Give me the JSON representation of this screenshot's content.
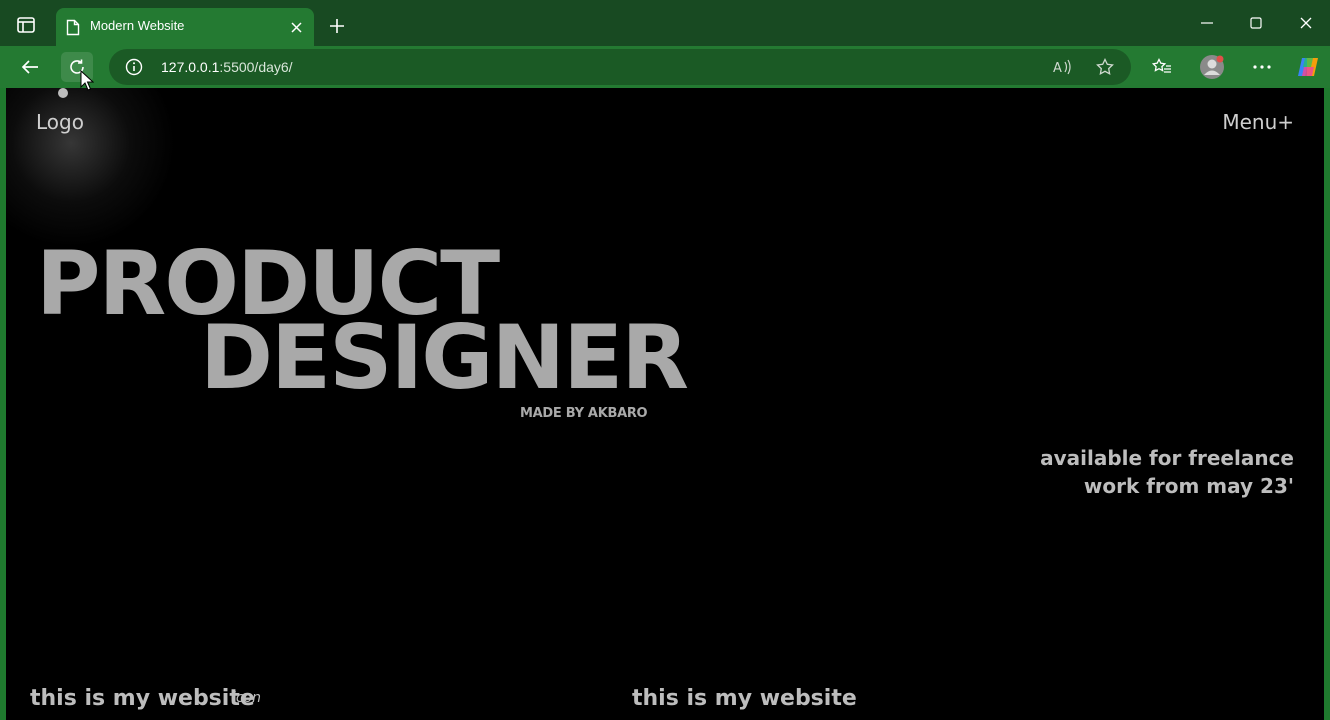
{
  "browser": {
    "tab_title": "Modern Website",
    "url_host": "127.0.0.1",
    "url_rest": ":5500/day6/",
    "icons": {
      "sidebar": "sidebar-toggle-icon",
      "tab_page": "page-icon",
      "tab_close": "close-icon",
      "new_tab": "plus-icon",
      "minimize": "minimize-icon",
      "maximize": "maximize-icon",
      "close_window": "close-icon",
      "back": "back-arrow-icon",
      "refresh": "refresh-icon",
      "info": "info-icon",
      "read_aloud": "read-aloud-icon",
      "favorite": "star-icon",
      "favorites": "favorites-list-icon",
      "profile": "avatar",
      "more": "more-icon",
      "copilot": "copilot-icon"
    }
  },
  "page": {
    "logo": "Logo",
    "menu": "Menu+",
    "heading_line1": "PRODUCT",
    "heading_line2": "DESIGNER",
    "made_by": "MADE BY AKBARO",
    "freelance_line1": "available for freelance",
    "freelance_line2": "work from may 23'",
    "footer_left": "this is my website",
    "footer_icon": "icon",
    "footer_mid": "this is my website"
  },
  "colors": {
    "chrome_dark": "#184a22",
    "chrome": "#247a32",
    "page_bg": "#000000",
    "heading": "#a9a9a9"
  }
}
